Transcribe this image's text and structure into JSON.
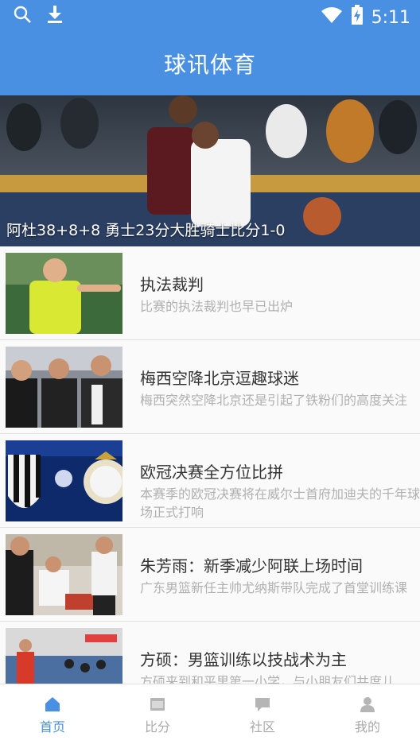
{
  "status_bar": {
    "time": "5:11",
    "icons": [
      "search-icon",
      "download-icon",
      "wifi-icon",
      "battery-icon"
    ]
  },
  "app_bar": {
    "title": "球讯体育"
  },
  "banner": {
    "caption": "阿杜38+8+8 勇士23分大胜骑士比分1-0",
    "dots": 3,
    "active_dot": 0
  },
  "news": [
    {
      "title": "执法裁判",
      "summary": "比赛的执法裁判也早已出炉"
    },
    {
      "title": "梅西空降北京逗趣球迷",
      "summary": "梅西突然空降北京还是引起了铁粉们的高度关注"
    },
    {
      "title": "欧冠决赛全方位比拼",
      "summary": "本赛季的欧冠决赛将在威尔士首府加迪夫的千年球场正式打响"
    },
    {
      "title": "朱芳雨：新季减少阿联上场时间",
      "summary": "广东男篮新任主帅尤纳斯带队完成了首堂训练课"
    },
    {
      "title": "方硕：男篮训练以技战术为主",
      "summary": "方硕来到和平里第一小学，与小朋友们共度儿"
    }
  ],
  "tabs": [
    {
      "label": "首页",
      "icon": "home-icon",
      "active": true
    },
    {
      "label": "比分",
      "icon": "scoreboard-icon",
      "active": false
    },
    {
      "label": "社区",
      "icon": "chat-icon",
      "active": false
    },
    {
      "label": "我的",
      "icon": "profile-icon",
      "active": false
    }
  ],
  "colors": {
    "primary": "#4a90e2",
    "inactive": "#a9a9a9",
    "summary": "#b0b0b0"
  }
}
